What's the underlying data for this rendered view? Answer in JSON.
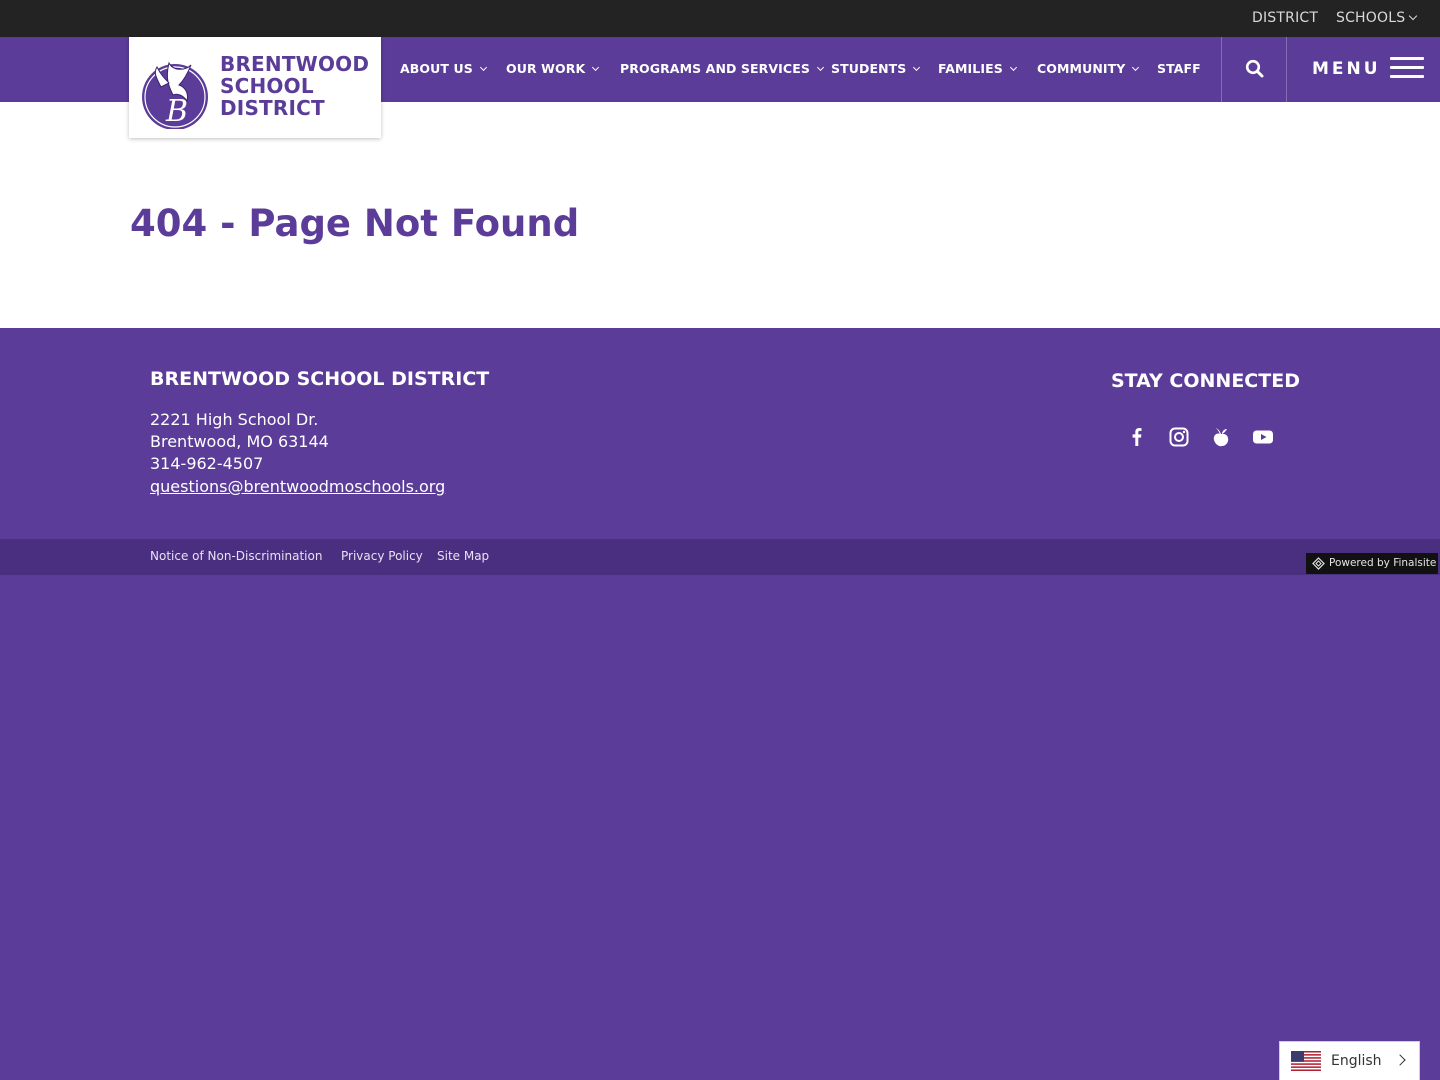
{
  "utility": {
    "district": "DISTRICT",
    "schools": "SCHOOLS"
  },
  "logo": {
    "line1": "BRENTWOOD",
    "line2": "SCHOOL",
    "line3": "DISTRICT",
    "seal_letter": "B"
  },
  "nav": {
    "items": [
      {
        "label": "ABOUT US",
        "has_dropdown": true
      },
      {
        "label": "OUR WORK",
        "has_dropdown": true
      },
      {
        "label": "PROGRAMS AND SERVICES",
        "has_dropdown": true
      },
      {
        "label": "STUDENTS",
        "has_dropdown": true
      },
      {
        "label": "FAMILIES",
        "has_dropdown": true
      },
      {
        "label": "COMMUNITY",
        "has_dropdown": true
      },
      {
        "label": "STAFF",
        "has_dropdown": false
      }
    ],
    "search_icon": "search-icon",
    "menu_label": "MENU"
  },
  "main": {
    "title": "404 - Page Not Found"
  },
  "footer": {
    "title": "BRENTWOOD SCHOOL DISTRICT",
    "address_line1": "2221 High School Dr.",
    "address_line2": "Brentwood, MO  63144",
    "phone": "314-962-4507",
    "email": "questions@brentwoodmoschools.org",
    "stay_connected": "STAY CONNECTED",
    "social": [
      "facebook-icon",
      "instagram-icon",
      "peachjar-icon",
      "youtube-icon"
    ],
    "links": [
      "Notice of Non-Discrimination",
      "Privacy Policy",
      "Site Map"
    ],
    "powered_by": "Powered by Finalsite"
  },
  "language": {
    "selected": "English"
  },
  "colors": {
    "brand_purple": "#5b3c98",
    "dark_purple": "#4a2f80",
    "utility_bg": "#232323"
  }
}
